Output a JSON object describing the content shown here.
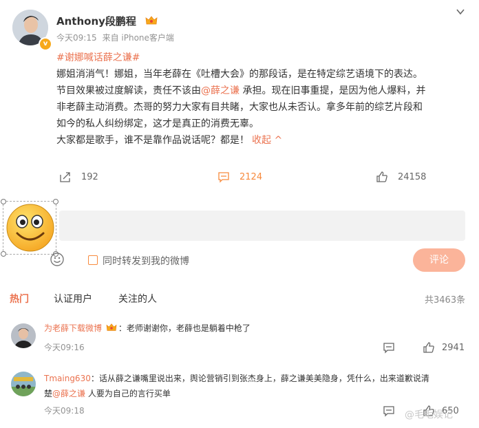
{
  "post": {
    "author_name": "Anthony段鹏程",
    "time": "今天09:15",
    "source": "来自 iPhone客户端",
    "hashtag": "#谢娜喊话薛之谦#",
    "text_line1": "娜姐消消气！娜姐，当年老薛在《吐槽大会》的那段话，是在特定综艺语境下的表达。",
    "text_line2_a": "节目效果被过度解读，责任不该由",
    "text_line2_mention": "@薛之谦",
    "text_line2_b": " 承担。现在旧事重提，是因为他人爆料，并",
    "text_line3": "非老薛主动消费。杰哥的努力大家有目共睹，大家也从未否认。拿多年前的综艺片段和",
    "text_line4": "如今的私人纠纷绑定，这才是真正的消费无辜。",
    "text_line5": "大家都是歌手，谁不是靠作品说话呢？都是！",
    "collapse_label": "收起",
    "share_count": "192",
    "comment_count": "2124",
    "like_count": "24158"
  },
  "composer": {
    "forward_label": "同时转发到我的微博",
    "submit_label": "评论"
  },
  "tabs": {
    "hot": "热门",
    "verified": "认证用户",
    "following": "关注的人",
    "total": "共3463条"
  },
  "comments": [
    {
      "user": "为老薛下载微博",
      "text": "：老师谢谢你，老薛也是躺着中枪了",
      "time": "今天09:16",
      "likes": "2941"
    },
    {
      "user": "Tmaing630",
      "text_a": "：话从薛之谦嘴里说出来，舆论营销引到张杰身上，薛之谦美美隐身，凭什么，出来道歉说清",
      "text_b_prefix": "楚",
      "mention": "@薛之谦",
      "text_b_suffix": " 人要为自己的言行买单",
      "time": "今天09:18",
      "likes": "650"
    }
  ],
  "watermark": "@毛毛娱记",
  "colors": {
    "accent": "#eb7350",
    "orange": "#f78a3d",
    "button": "#fbb49a",
    "input_bg": "#f2f2f2"
  }
}
